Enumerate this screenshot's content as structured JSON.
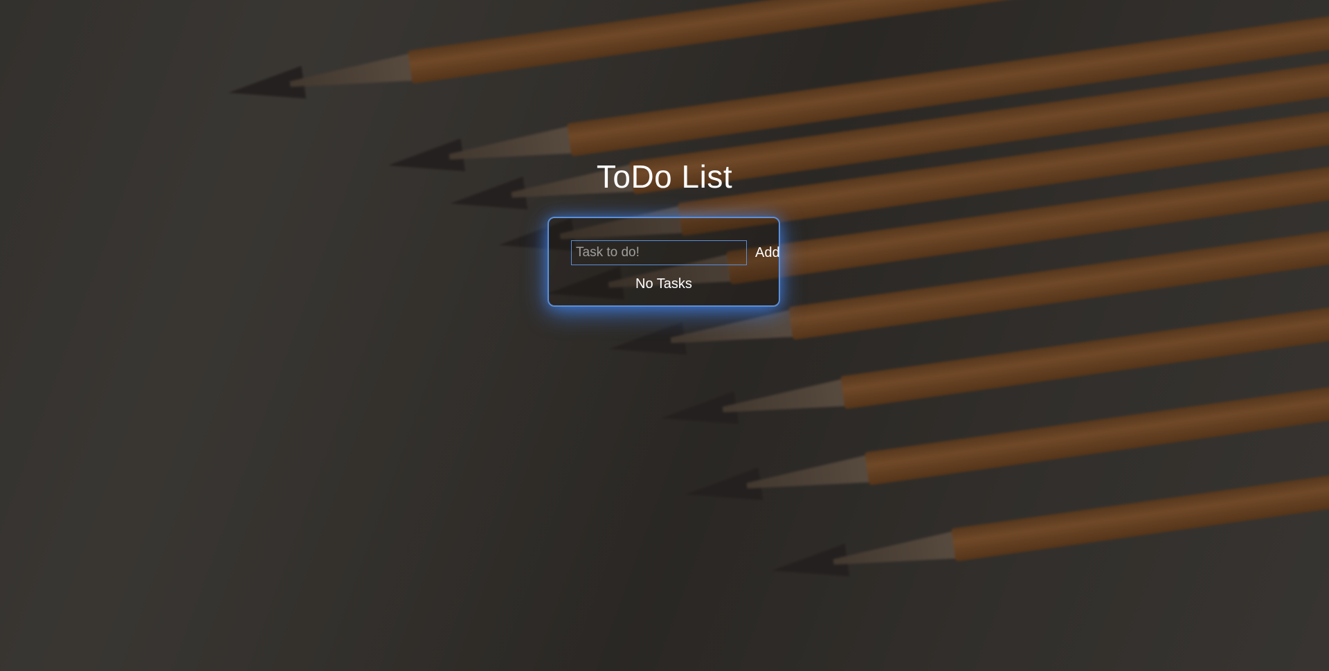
{
  "app": {
    "title": "ToDo List"
  },
  "form": {
    "task_placeholder": "Task to do!",
    "task_value": "",
    "add_label": "Add"
  },
  "list": {
    "empty_text": "No Tasks",
    "tasks": []
  },
  "colors": {
    "accent": "#5b8fd8",
    "text": "#ffffff"
  }
}
